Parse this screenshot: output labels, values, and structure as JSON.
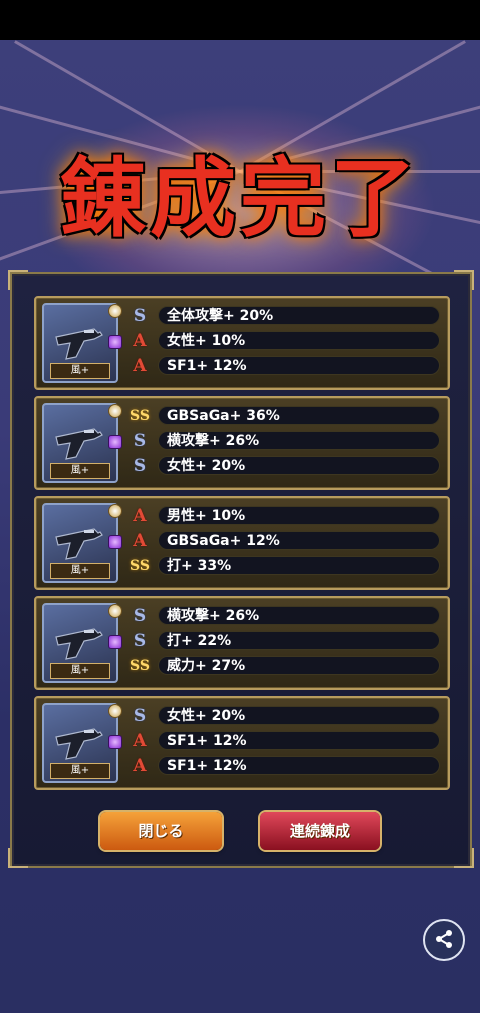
{
  "title": "錬成完了",
  "cards": [
    {
      "element": "風+",
      "rows": [
        {
          "rank": "S",
          "rank_label": "S",
          "text": "全体攻撃+ 20%"
        },
        {
          "rank": "A",
          "rank_label": "A",
          "text": "女性+ 10%"
        },
        {
          "rank": "A",
          "rank_label": "A",
          "text": "SF1+ 12%"
        }
      ]
    },
    {
      "element": "風+",
      "rows": [
        {
          "rank": "SS",
          "rank_label": "SS",
          "text": "GBSaGa+ 36%"
        },
        {
          "rank": "S",
          "rank_label": "S",
          "text": "横攻撃+ 26%"
        },
        {
          "rank": "S",
          "rank_label": "S",
          "text": "女性+ 20%"
        }
      ]
    },
    {
      "element": "風+",
      "rows": [
        {
          "rank": "A",
          "rank_label": "A",
          "text": "男性+ 10%"
        },
        {
          "rank": "A",
          "rank_label": "A",
          "text": "GBSaGa+ 12%"
        },
        {
          "rank": "SS",
          "rank_label": "SS",
          "text": "打+ 33%"
        }
      ]
    },
    {
      "element": "風+",
      "rows": [
        {
          "rank": "S",
          "rank_label": "S",
          "text": "横攻撃+ 26%"
        },
        {
          "rank": "S",
          "rank_label": "S",
          "text": "打+ 22%"
        },
        {
          "rank": "SS",
          "rank_label": "SS",
          "text": "威力+ 27%"
        }
      ]
    },
    {
      "element": "風+",
      "rows": [
        {
          "rank": "S",
          "rank_label": "S",
          "text": "女性+ 20%"
        },
        {
          "rank": "A",
          "rank_label": "A",
          "text": "SF1+ 12%"
        },
        {
          "rank": "A",
          "rank_label": "A",
          "text": "SF1+ 12%"
        }
      ]
    }
  ],
  "buttons": {
    "close": "閉じる",
    "repeat": "連続錬成"
  },
  "icons": {
    "share": "share-icon",
    "weapon": "pistol-icon"
  },
  "colors": {
    "rank_S": "#a9b9e6",
    "rank_SS": "#ffd86a",
    "rank_A": "#e24a36",
    "close_button": "#e07a20",
    "repeat_button": "#c02838"
  }
}
